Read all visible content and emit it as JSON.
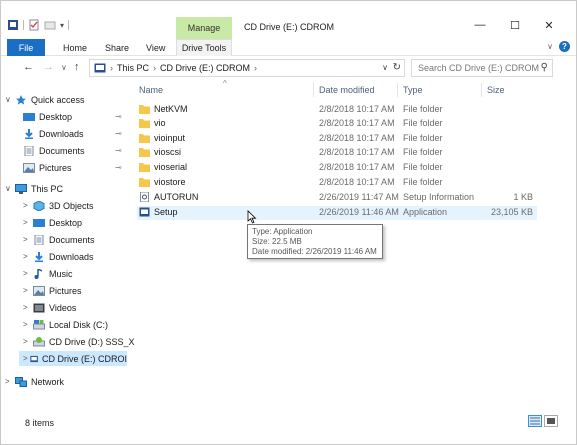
{
  "window": {
    "title": "CD Drive (E:) CDROM",
    "manage_label": "Manage",
    "minimize": "—",
    "maximize": "☐",
    "close": "✕"
  },
  "ribbon": {
    "tabs": [
      {
        "label": "File"
      },
      {
        "label": "Home"
      },
      {
        "label": "Share"
      },
      {
        "label": "View"
      },
      {
        "label": "Drive Tools"
      }
    ]
  },
  "address": {
    "crumbs": [
      "This PC",
      "CD Drive (E:) CDROM"
    ],
    "search_placeholder": "Search CD Drive (E:) CDROM"
  },
  "navpane": {
    "items": [
      {
        "label": "Quick access",
        "icon": "star-icon",
        "chev": "∨",
        "pinned": false
      },
      {
        "label": "Desktop",
        "icon": "desktop-icon",
        "chev": "",
        "pinned": true
      },
      {
        "label": "Downloads",
        "icon": "download-icon",
        "chev": "",
        "pinned": true
      },
      {
        "label": "Documents",
        "icon": "documents-icon",
        "chev": "",
        "pinned": true
      },
      {
        "label": "Pictures",
        "icon": "pictures-icon",
        "chev": "",
        "pinned": true
      },
      {
        "label": "This PC",
        "icon": "computer-icon",
        "chev": "∨",
        "pinned": false
      },
      {
        "label": "3D Objects",
        "icon": "cube-icon",
        "chev": ">",
        "pinned": false
      },
      {
        "label": "Desktop",
        "icon": "desktop-icon",
        "chev": ">",
        "pinned": false
      },
      {
        "label": "Documents",
        "icon": "documents-icon",
        "chev": ">",
        "pinned": false
      },
      {
        "label": "Downloads",
        "icon": "download-icon",
        "chev": ">",
        "pinned": false
      },
      {
        "label": "Music",
        "icon": "music-icon",
        "chev": ">",
        "pinned": false
      },
      {
        "label": "Pictures",
        "icon": "pictures-icon",
        "chev": ">",
        "pinned": false
      },
      {
        "label": "Videos",
        "icon": "videos-icon",
        "chev": ">",
        "pinned": false
      },
      {
        "label": "Local Disk (C:)",
        "icon": "disk-icon",
        "chev": ">",
        "pinned": false
      },
      {
        "label": "CD Drive (D:) SSS_X",
        "icon": "cd-drive-icon",
        "chev": ">",
        "pinned": false
      },
      {
        "label": "CD Drive (E:) CDROI",
        "icon": "cd-drive-icon",
        "chev": ">",
        "pinned": false
      },
      {
        "label": "Network",
        "icon": "network-icon",
        "chev": ">",
        "pinned": false
      }
    ],
    "pin_glyph": "⊸"
  },
  "columns": {
    "name": "Name",
    "date": "Date modified",
    "type": "Type",
    "size": "Size"
  },
  "files": [
    {
      "name": "NetKVM",
      "date": "2/8/2018 10:17 AM",
      "type": "File folder",
      "size": "",
      "icon": "folder-icon"
    },
    {
      "name": "vio",
      "date": "2/8/2018 10:17 AM",
      "type": "File folder",
      "size": "",
      "icon": "folder-icon"
    },
    {
      "name": "vioinput",
      "date": "2/8/2018 10:17 AM",
      "type": "File folder",
      "size": "",
      "icon": "folder-icon"
    },
    {
      "name": "vioscsi",
      "date": "2/8/2018 10:17 AM",
      "type": "File folder",
      "size": "",
      "icon": "folder-icon"
    },
    {
      "name": "vioserial",
      "date": "2/8/2018 10:17 AM",
      "type": "File folder",
      "size": "",
      "icon": "folder-icon"
    },
    {
      "name": "viostore",
      "date": "2/8/2018 10:17 AM",
      "type": "File folder",
      "size": "",
      "icon": "folder-icon"
    },
    {
      "name": "AUTORUN",
      "date": "2/26/2019 11:47 AM",
      "type": "Setup Information",
      "size": "1 KB",
      "icon": "setup-info-icon"
    },
    {
      "name": "Setup",
      "date": "2/26/2019 11:46 AM",
      "type": "Application",
      "size": "23,105 KB",
      "icon": "application-icon"
    }
  ],
  "tooltip": {
    "line1": "Type: Application",
    "line2": "Size: 22.5 MB",
    "line3": "Date modified: 2/26/2019 11:46 AM"
  },
  "status": {
    "count": "8 items"
  },
  "colors": {
    "accent": "#1a6fc4",
    "manage_bg": "#c9e9a6",
    "folder": "#f5c84b",
    "selected": "#cce8ff"
  }
}
